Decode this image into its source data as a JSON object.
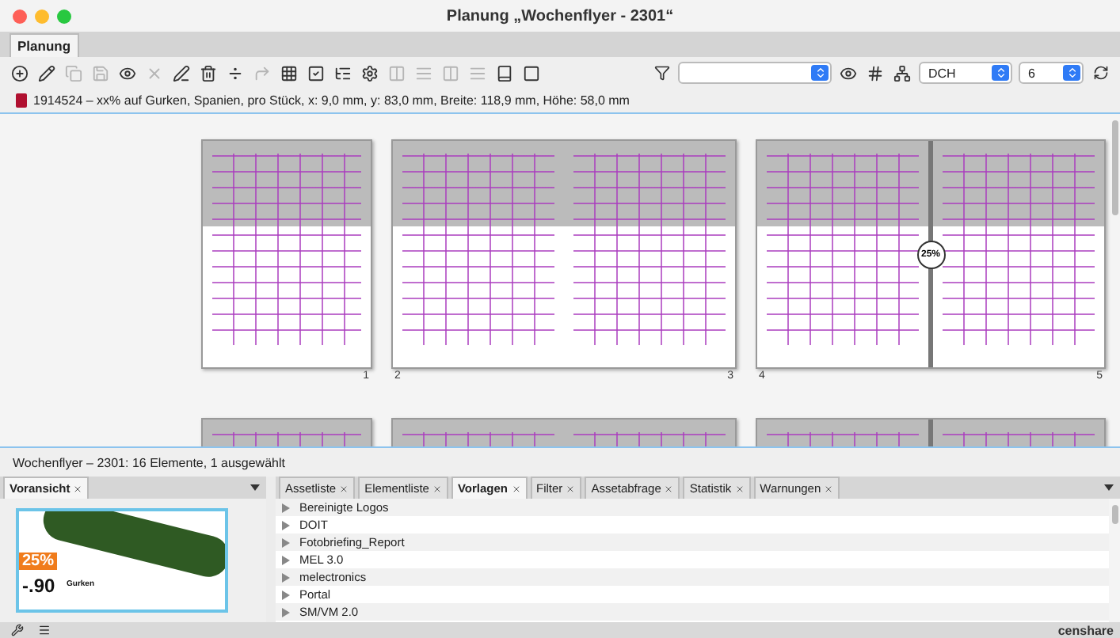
{
  "window": {
    "title": "Planung „Wochenflyer - 2301“"
  },
  "tabs": [
    {
      "label": "Planung",
      "selected": true
    }
  ],
  "toolbar": {
    "channel_select": {
      "value": "DCH"
    },
    "count_select": {
      "value": "6"
    }
  },
  "selection_info": "1914524 – xx% auf Gurken,  Spanien, pro Stück, x: 9,0 mm, y: 83,0 mm, Breite: 118,9 mm, Höhe: 58,0 mm",
  "spreads": [
    {
      "pages": [
        {
          "number": "1"
        }
      ]
    },
    {
      "pages": [
        {
          "number": "2"
        },
        {
          "number": "3"
        }
      ]
    },
    {
      "pages": [
        {
          "number": "4"
        },
        {
          "number": "5"
        }
      ]
    }
  ],
  "zoom_badge": "25%",
  "status": "Wochenflyer – 2301: 16 Elemente, 1 ausgewählt",
  "preview_panel": {
    "tab": "Voransicht",
    "discount": "25%",
    "price": "-.90",
    "product": "Gurken"
  },
  "asset_panel": {
    "tabs": [
      {
        "label": "Assetliste",
        "selected": false
      },
      {
        "label": "Elementliste",
        "selected": false
      },
      {
        "label": "Vorlagen",
        "selected": true
      },
      {
        "label": "Filter",
        "selected": false
      },
      {
        "label": "Assetabfrage",
        "selected": false
      },
      {
        "label": "Statistik",
        "selected": false
      },
      {
        "label": "Warnungen",
        "selected": false
      }
    ],
    "items": [
      {
        "label": "Bereinigte Logos"
      },
      {
        "label": "DOIT"
      },
      {
        "label": "Fotobriefing_Report"
      },
      {
        "label": "MEL 3.0"
      },
      {
        "label": "melectronics"
      },
      {
        "label": "Portal"
      },
      {
        "label": "SM/VM 2.0"
      }
    ]
  },
  "logo": "censhare"
}
